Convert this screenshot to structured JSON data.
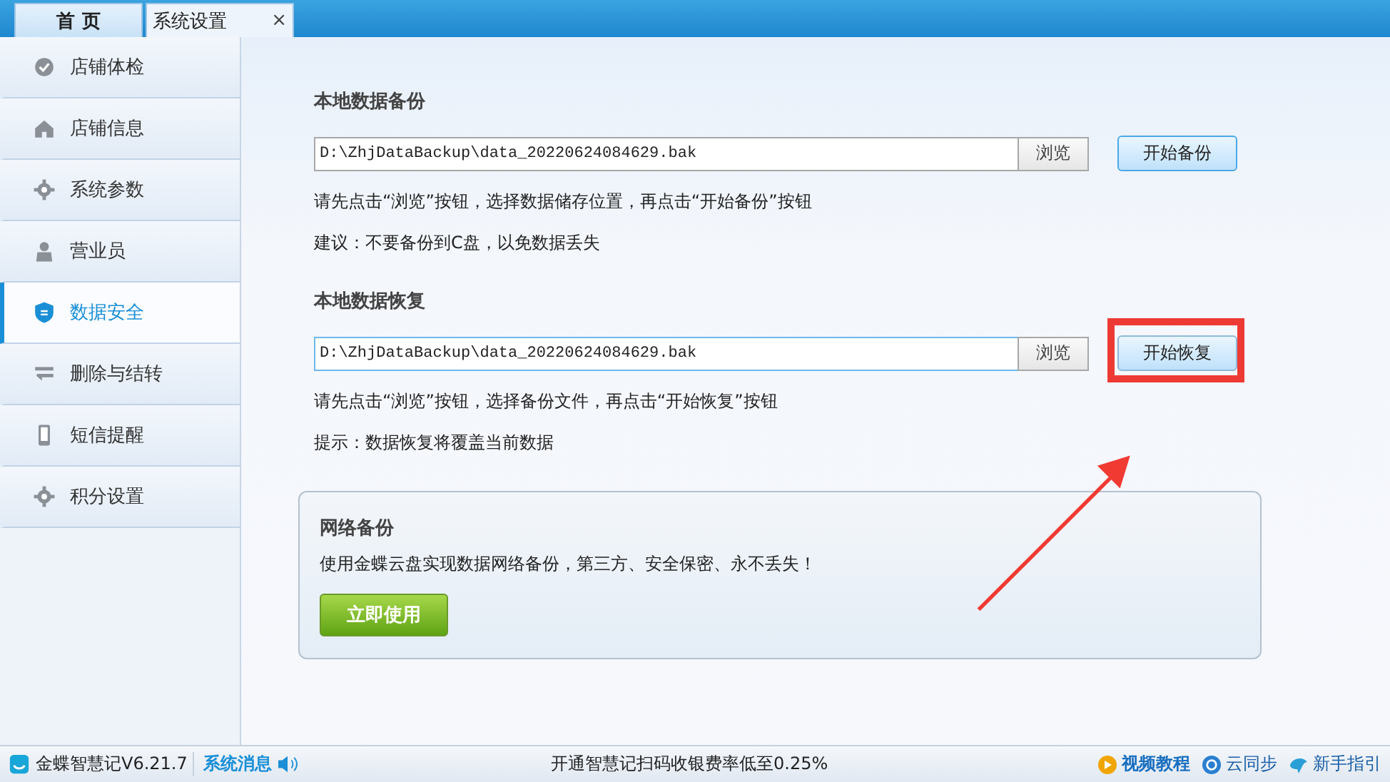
{
  "tabs": [
    {
      "label": "首 页",
      "selected": false
    },
    {
      "label": "系统设置",
      "selected": true,
      "close": "×"
    }
  ],
  "sidebar": {
    "items": [
      {
        "label": "店铺体检",
        "selected": false
      },
      {
        "label": "店铺信息",
        "selected": false
      },
      {
        "label": "系统参数",
        "selected": false
      },
      {
        "label": "营业员",
        "selected": false
      },
      {
        "label": "数据安全",
        "selected": true
      },
      {
        "label": "删除与结转",
        "selected": false
      },
      {
        "label": "短信提醒",
        "selected": false
      },
      {
        "label": "积分设置",
        "selected": false
      }
    ]
  },
  "backup": {
    "title": "本地数据备份",
    "path": "D:\\ZhjDataBackup\\data_20220624084629.bak",
    "browse": "浏览",
    "action": "开始备份",
    "focused": false,
    "notes": [
      "请先点击“浏览”按钮，选择数据储存位置，再点击“开始备份”按钮",
      "建议：不要备份到C盘，以免数据丢失"
    ]
  },
  "restore": {
    "title": "本地数据恢复",
    "path": "D:\\ZhjDataBackup\\data_20220624084629.bak",
    "browse": "浏览",
    "action": "开始恢复",
    "focused": true,
    "notes": [
      "请先点击“浏览”按钮，选择备份文件，再点击“开始恢复”按钮",
      "提示：数据恢复将覆盖当前数据"
    ]
  },
  "cloud": {
    "title": "网络备份",
    "text": "使用金蝶云盘实现数据网络备份，第三方、安全保密、永不丢失！",
    "button": "立即使用"
  },
  "status_bar": {
    "app": "金蝶智慧记V6.21.7",
    "messages": "系统消息",
    "promo": "开通智慧记扫码收银费率低至0.25%",
    "video": "视频教程",
    "sync": "云同步",
    "guide": "新手指引"
  }
}
